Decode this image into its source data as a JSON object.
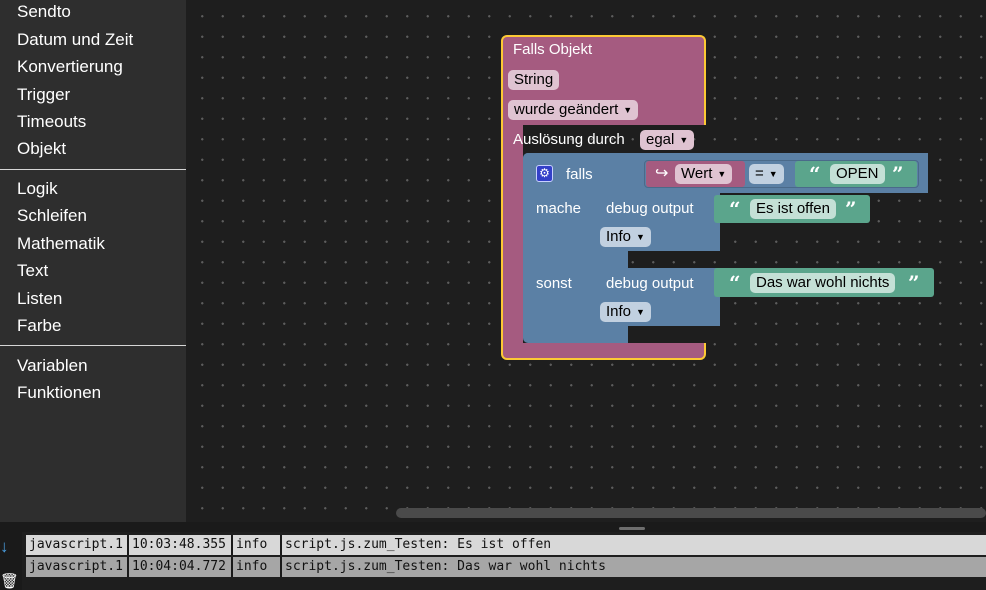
{
  "sidebar": {
    "group1": [
      "Sendto",
      "Datum und Zeit",
      "Konvertierung",
      "Trigger",
      "Timeouts",
      "Objekt"
    ],
    "group2": [
      "Logik",
      "Schleifen",
      "Mathematik",
      "Text",
      "Listen",
      "Farbe"
    ],
    "group3": [
      "Variablen",
      "Funktionen"
    ]
  },
  "trigger_block": {
    "title": "Falls Objekt",
    "object_type": "String",
    "condition": "wurde geändert",
    "trigger_by_label": "Auslösung durch",
    "trigger_by_value": "egal",
    "colors": {
      "fill": "#a55b80",
      "highlight": "#fcc934"
    }
  },
  "if_block": {
    "if_label": "falls",
    "then_label": "mache",
    "else_label": "sonst",
    "compare": {
      "left_label": "Wert",
      "operator": "=",
      "right_text": "OPEN"
    },
    "colors": {
      "fill": "#5b80a5",
      "text_fill": "#5ba58c"
    }
  },
  "debug_then": {
    "label": "debug output",
    "text": "Es ist offen",
    "level": "Info"
  },
  "debug_else": {
    "label": "debug output",
    "text": "Das war wohl nichts",
    "level": "Info"
  },
  "log": [
    {
      "source": "javascript.1",
      "time": "10:03:48.355",
      "level": "info",
      "message": "script.js.zum_Testen: Es ist offen"
    },
    {
      "source": "javascript.1",
      "time": "10:04:04.772",
      "level": "info",
      "message": "script.js.zum_Testen: Das war wohl nichts"
    }
  ]
}
